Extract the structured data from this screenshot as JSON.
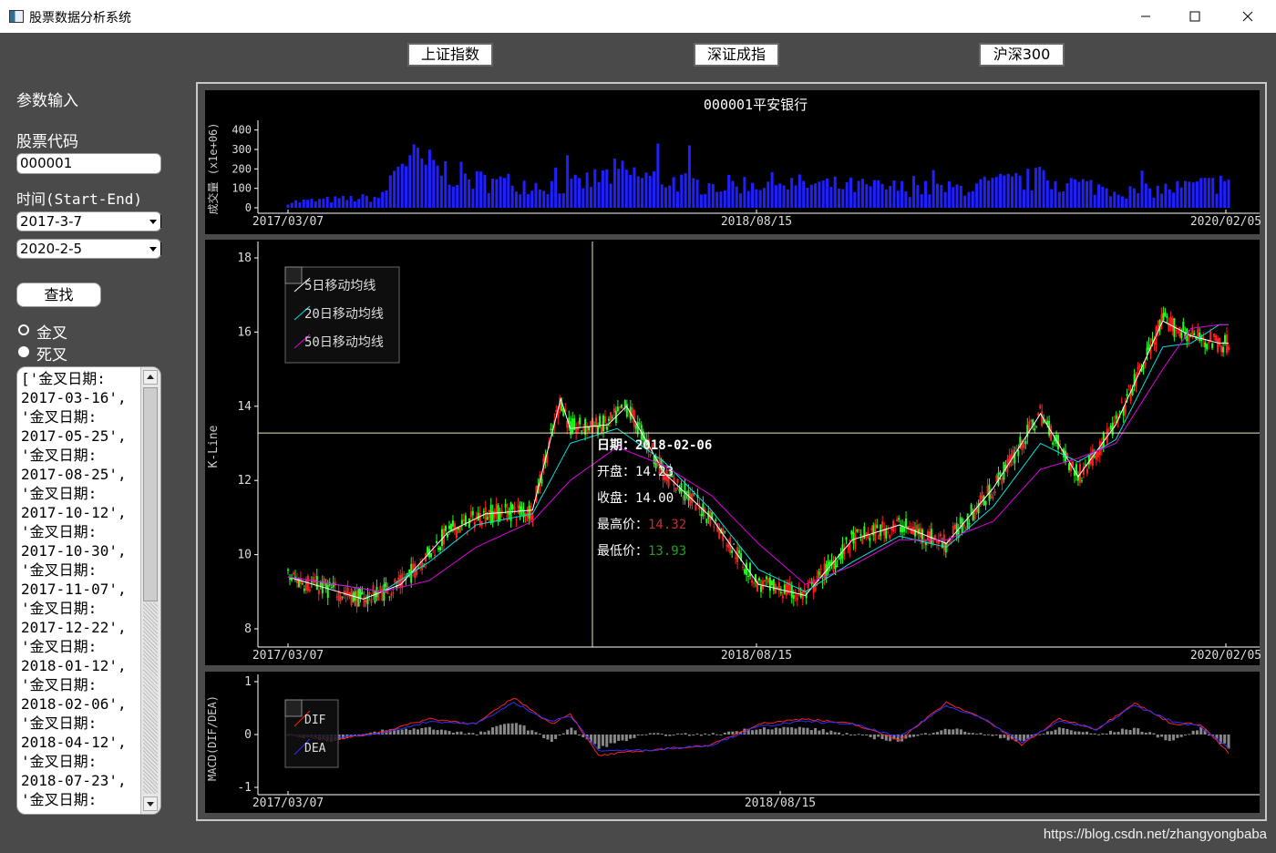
{
  "window": {
    "title": "股票数据分析系统"
  },
  "toolbar": {
    "buttons": [
      "上证指数",
      "深证成指",
      "沪深300"
    ]
  },
  "sidebar": {
    "section_title": "参数输入",
    "code_label": "股票代码",
    "code_value": "000001",
    "time_label": "时间(Start-End)",
    "start_date": "2017-3-7",
    "end_date": "2020-2-5",
    "query_button": "查找",
    "radio_golden": "金叉",
    "radio_death": "死叉",
    "radio_selected": "死叉",
    "list_text": "['金叉日期:\n2017-03-16',\n'金叉日期:\n2017-05-25',\n'金叉日期:\n2017-08-25',\n'金叉日期:\n2017-10-12',\n'金叉日期:\n2017-10-30',\n'金叉日期:\n2017-11-07',\n'金叉日期:\n2017-12-22',\n'金叉日期:\n2018-01-12',\n'金叉日期:\n2018-02-06',\n'金叉日期:\n2018-04-12',\n'金叉日期:\n2018-07-23',\n'金叉日期:"
  },
  "volume_chart": {
    "title": "000001平安银行",
    "ylabel": "成交量 (x1e+06)",
    "yticks": [
      "0",
      "100",
      "200",
      "300",
      "400"
    ],
    "ylim": [
      0,
      450
    ],
    "xticks": [
      "2017/03/07",
      "2018/08/15",
      "2020/02/05"
    ],
    "bar_color": "#1f1fff"
  },
  "kline_chart": {
    "ylabel": "K-Line",
    "yticks": [
      "8",
      "10",
      "12",
      "14",
      "16",
      "18"
    ],
    "ylim": [
      7.7,
      18.4
    ],
    "xticks": [
      "2017/03/07",
      "2018/08/15",
      "2020/02/05"
    ],
    "legend": [
      "5日移动均线",
      "20日移动均线",
      "50日移动均线"
    ],
    "ma_colors": [
      "#ffffff",
      "#00e0e0",
      "#e000e0"
    ],
    "up_color": "#ff2020",
    "down_color": "#20ff20"
  },
  "tooltip": {
    "date_label": "日期：",
    "date_value": "2018-02-06",
    "open_label": "开盘：",
    "open_value": "14.23",
    "close_label": "收盘：",
    "close_value": "14.00",
    "high_label": "最高价：",
    "high_value": "14.32",
    "low_label": "最低价：",
    "low_value": "13.93",
    "crosshair_price": 13.28
  },
  "macd_chart": {
    "ylabel": "MACD(DIF/DEA)",
    "yticks": [
      "-1",
      "0",
      "1"
    ],
    "ylim": [
      -1.15,
      1.15
    ],
    "xticks": [
      "2017/03/07",
      "2018/08/15"
    ],
    "legend": [
      "DIF",
      "DEA"
    ],
    "dif_color": "#ff2020",
    "dea_color": "#3030ff"
  },
  "chart_data": [
    {
      "type": "bar",
      "title": "000001平安银行",
      "ylabel": "成交量 (x1e+06)",
      "x_range": [
        "2017/03/07",
        "2020/02/05"
      ],
      "ylim": [
        0,
        450
      ],
      "approx_profile": [
        [
          0,
          30
        ],
        [
          0.1,
          55
        ],
        [
          0.12,
          260
        ],
        [
          0.2,
          140
        ],
        [
          0.3,
          110
        ],
        [
          0.35,
          180
        ],
        [
          0.45,
          110
        ],
        [
          0.5,
          130
        ],
        [
          0.6,
          110
        ],
        [
          0.7,
          95
        ],
        [
          0.8,
          150
        ],
        [
          0.9,
          80
        ],
        [
          1.0,
          130
        ]
      ]
    },
    {
      "type": "line",
      "title": "K-Line",
      "series": [
        {
          "name": "5日移动均线",
          "profile": [
            [
              0,
              9.4
            ],
            [
              0.08,
              8.8
            ],
            [
              0.12,
              9.2
            ],
            [
              0.17,
              10.6
            ],
            [
              0.21,
              11.1
            ],
            [
              0.26,
              11.2
            ],
            [
              0.29,
              14.2
            ],
            [
              0.3,
              13.4
            ],
            [
              0.34,
              13.5
            ],
            [
              0.36,
              14.0
            ],
            [
              0.4,
              12.2
            ],
            [
              0.45,
              11.0
            ],
            [
              0.5,
              9.2
            ],
            [
              0.55,
              8.9
            ],
            [
              0.6,
              10.4
            ],
            [
              0.65,
              10.8
            ],
            [
              0.7,
              10.3
            ],
            [
              0.75,
              11.8
            ],
            [
              0.8,
              13.8
            ],
            [
              0.84,
              12.1
            ],
            [
              0.88,
              13.5
            ],
            [
              0.93,
              16.3
            ],
            [
              0.96,
              15.9
            ],
            [
              0.99,
              15.7
            ]
          ]
        },
        {
          "name": "20日移动均线",
          "profile": [
            [
              0,
              9.4
            ],
            [
              0.1,
              9.0
            ],
            [
              0.15,
              9.8
            ],
            [
              0.2,
              10.8
            ],
            [
              0.26,
              11.1
            ],
            [
              0.3,
              13.0
            ],
            [
              0.35,
              13.4
            ],
            [
              0.4,
              12.5
            ],
            [
              0.45,
              11.2
            ],
            [
              0.5,
              9.6
            ],
            [
              0.55,
              9.0
            ],
            [
              0.6,
              9.8
            ],
            [
              0.65,
              10.5
            ],
            [
              0.7,
              10.2
            ],
            [
              0.75,
              11.3
            ],
            [
              0.8,
              13.0
            ],
            [
              0.84,
              12.5
            ],
            [
              0.88,
              13.1
            ],
            [
              0.93,
              15.6
            ],
            [
              0.96,
              15.7
            ],
            [
              0.99,
              16.2
            ]
          ]
        },
        {
          "name": "50日移动均线",
          "profile": [
            [
              0,
              9.4
            ],
            [
              0.1,
              9.0
            ],
            [
              0.15,
              9.3
            ],
            [
              0.2,
              10.2
            ],
            [
              0.26,
              10.9
            ],
            [
              0.3,
              12.0
            ],
            [
              0.35,
              12.9
            ],
            [
              0.4,
              12.4
            ],
            [
              0.45,
              11.6
            ],
            [
              0.5,
              10.3
            ],
            [
              0.55,
              9.2
            ],
            [
              0.6,
              9.7
            ],
            [
              0.65,
              10.4
            ],
            [
              0.7,
              10.4
            ],
            [
              0.75,
              10.9
            ],
            [
              0.8,
              12.3
            ],
            [
              0.84,
              12.6
            ],
            [
              0.88,
              13.0
            ],
            [
              0.93,
              15.0
            ],
            [
              0.96,
              16.1
            ],
            [
              0.99,
              16.2
            ]
          ]
        }
      ],
      "ylim": [
        7.7,
        18.4
      ],
      "x_range": [
        "2017/03/07",
        "2020/02/05"
      ]
    },
    {
      "type": "line",
      "title": "MACD(DIF/DEA)",
      "series": [
        {
          "name": "DIF",
          "profile": [
            [
              0,
              0
            ],
            [
              0.05,
              -0.1
            ],
            [
              0.1,
              0.05
            ],
            [
              0.15,
              0.3
            ],
            [
              0.2,
              0.2
            ],
            [
              0.24,
              0.7
            ],
            [
              0.28,
              0.2
            ],
            [
              0.3,
              0.4
            ],
            [
              0.33,
              -0.4
            ],
            [
              0.38,
              -0.3
            ],
            [
              0.45,
              -0.2
            ],
            [
              0.5,
              0.2
            ],
            [
              0.55,
              0.3
            ],
            [
              0.6,
              0.2
            ],
            [
              0.65,
              -0.1
            ],
            [
              0.7,
              0.6
            ],
            [
              0.74,
              0.3
            ],
            [
              0.78,
              -0.2
            ],
            [
              0.82,
              0.3
            ],
            [
              0.86,
              0.1
            ],
            [
              0.9,
              0.6
            ],
            [
              0.94,
              0.2
            ],
            [
              0.97,
              0.2
            ],
            [
              1.0,
              -0.35
            ]
          ]
        },
        {
          "name": "DEA",
          "profile": [
            [
              0,
              0
            ],
            [
              0.05,
              -0.05
            ],
            [
              0.1,
              0.02
            ],
            [
              0.15,
              0.25
            ],
            [
              0.2,
              0.2
            ],
            [
              0.24,
              0.6
            ],
            [
              0.28,
              0.25
            ],
            [
              0.3,
              0.35
            ],
            [
              0.33,
              -0.3
            ],
            [
              0.38,
              -0.3
            ],
            [
              0.45,
              -0.2
            ],
            [
              0.5,
              0.15
            ],
            [
              0.55,
              0.25
            ],
            [
              0.6,
              0.2
            ],
            [
              0.65,
              -0.05
            ],
            [
              0.7,
              0.55
            ],
            [
              0.74,
              0.3
            ],
            [
              0.78,
              -0.15
            ],
            [
              0.82,
              0.25
            ],
            [
              0.86,
              0.1
            ],
            [
              0.9,
              0.55
            ],
            [
              0.94,
              0.25
            ],
            [
              0.97,
              0.15
            ],
            [
              1.0,
              -0.25
            ]
          ]
        }
      ],
      "ylim": [
        -1.15,
        1.15
      ]
    }
  ]
}
